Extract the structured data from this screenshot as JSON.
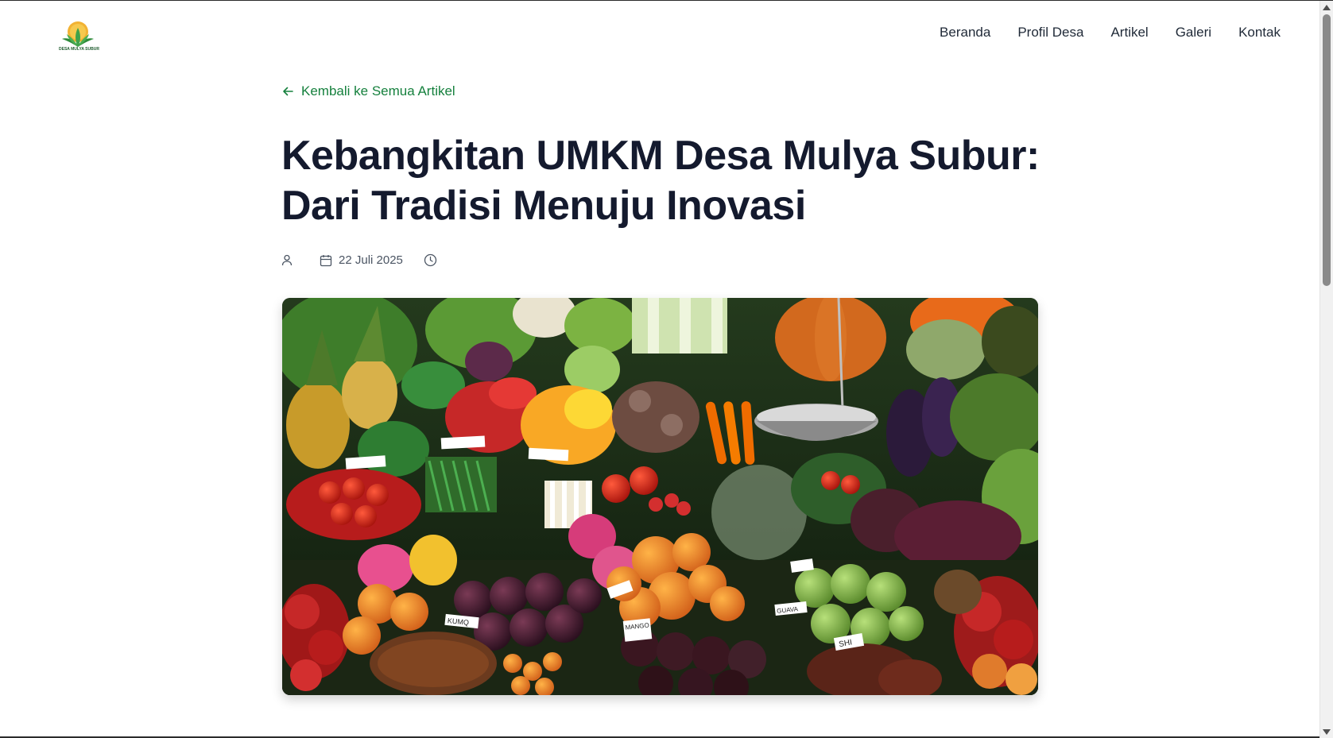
{
  "brand": {
    "logo_text": "DESA MULYA SUBUR",
    "logo_icon": "sun-leaves-logo"
  },
  "nav": {
    "items": [
      {
        "label": "Beranda"
      },
      {
        "label": "Profil Desa"
      },
      {
        "label": "Artikel"
      },
      {
        "label": "Galeri"
      },
      {
        "label": "Kontak"
      }
    ]
  },
  "article": {
    "back_label": "Kembali ke Semua Artikel",
    "title": "Kebangkitan UMKM Desa Mulya Subur: Dari Tradisi Menuju Inovasi",
    "author": "",
    "date": "22 Juli 2025",
    "reading_time": "",
    "hero_image": "market-produce-photo",
    "produce_labels": [
      "KUMQ",
      "MANGO",
      "SHI",
      "GUAVA"
    ]
  },
  "colors": {
    "accent": "#15803d",
    "title": "#141a2e",
    "text": "#1f2937"
  }
}
